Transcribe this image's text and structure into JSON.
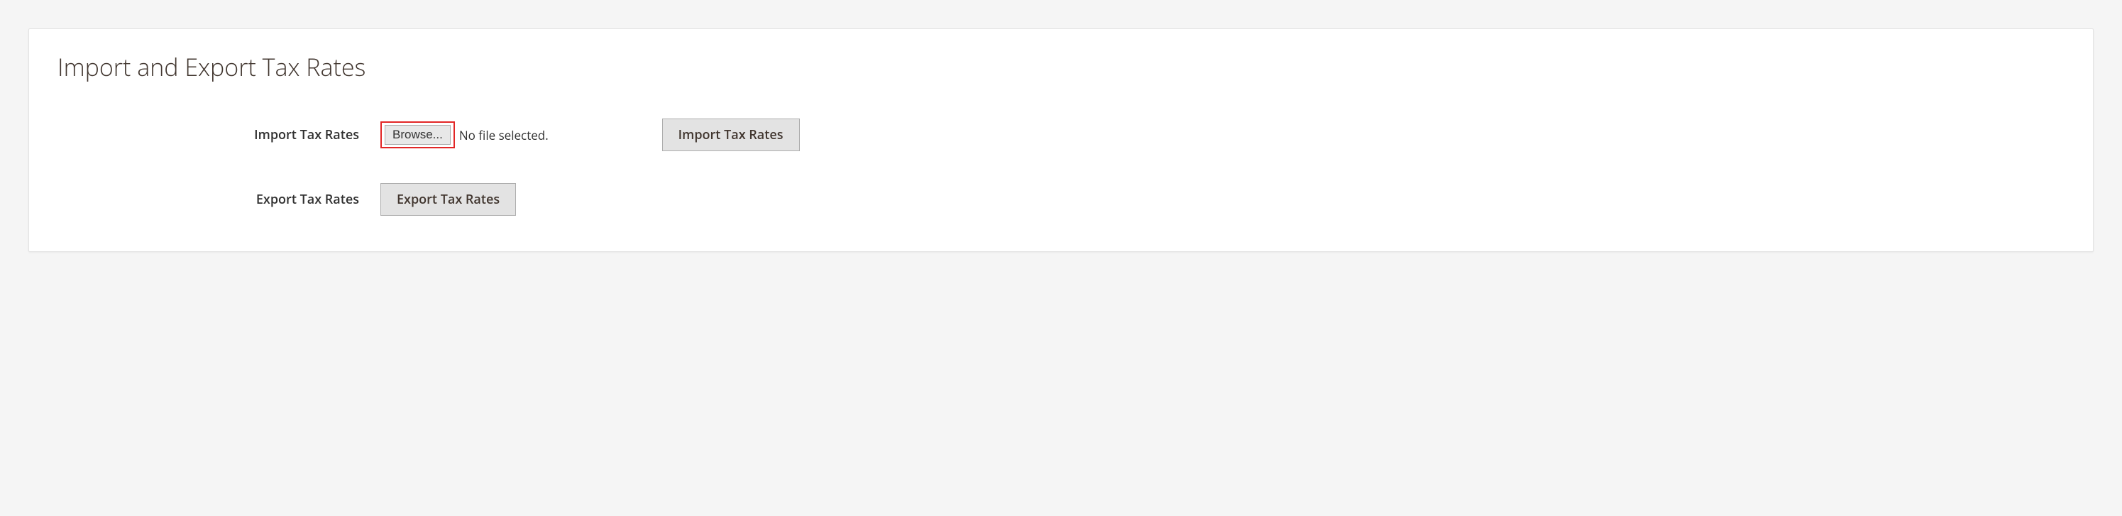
{
  "panel": {
    "title": "Import and Export Tax Rates"
  },
  "importRow": {
    "label": "Import Tax Rates",
    "browseLabel": "Browse...",
    "fileStatus": "No file selected.",
    "actionLabel": "Import Tax Rates"
  },
  "exportRow": {
    "label": "Export Tax Rates",
    "actionLabel": "Export Tax Rates"
  }
}
